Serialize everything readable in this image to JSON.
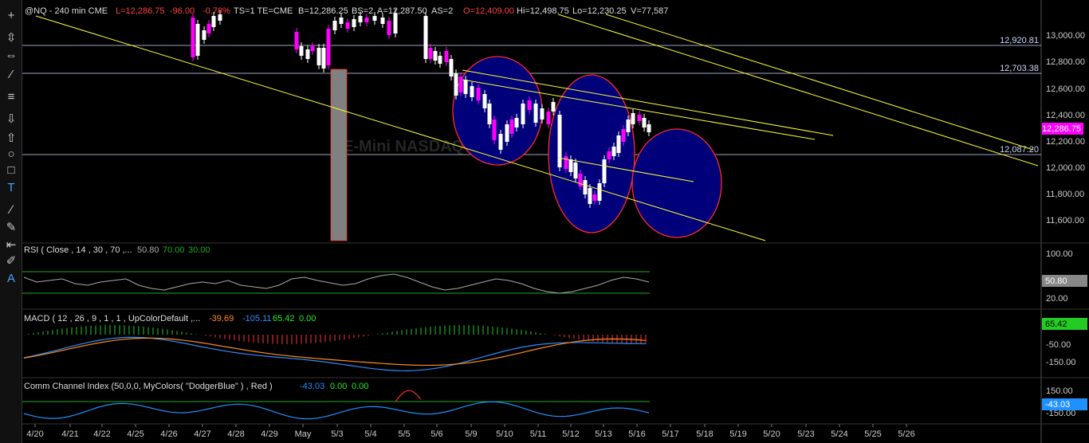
{
  "toolbar": {
    "tools": [
      {
        "icon": "crosshair-icon",
        "glyph": "+"
      },
      {
        "icon": "vertical-resize-icon",
        "glyph": "⇳"
      },
      {
        "icon": "horizontal-resize-icon",
        "glyph": "⇔"
      },
      {
        "icon": "trendline-icon",
        "glyph": "⁄"
      },
      {
        "icon": "horizontal-lines-icon",
        "glyph": "≡"
      },
      {
        "icon": "arrow-down-icon",
        "glyph": "⇩"
      },
      {
        "icon": "arrow-up-icon",
        "glyph": "⇧"
      },
      {
        "icon": "ellipse-icon",
        "glyph": "○"
      },
      {
        "icon": "rectangle-icon",
        "glyph": "□"
      },
      {
        "icon": "text-tool-icon",
        "glyph": "T"
      },
      {
        "icon": "pencil-icon",
        "glyph": "∕"
      },
      {
        "icon": "eraser-icon",
        "glyph": "✎"
      },
      {
        "icon": "fibonacci-icon",
        "glyph": "⇤"
      },
      {
        "icon": "pen-icon",
        "glyph": "✐"
      },
      {
        "icon": "text-label-icon",
        "glyph": "A"
      }
    ]
  },
  "header": {
    "symbol": "@NQ - 240 min  CME",
    "last": "L=12,286.75",
    "change": "-96.00",
    "change_pct": "-0.78%",
    "ts": "TS=1  TE=CME",
    "bid": "B=12,286.25",
    "bid_size": "BS=2",
    "ask": "A=12,287.50",
    "ask_size": "AS=2",
    "open": "O=12,409.00",
    "high": "Hi=12,498.75",
    "low": "Lo=12,230.25",
    "volume": "V=77,587"
  },
  "watermark": "E-Mini NASDAQ 100",
  "price_axis": {
    "ticks": [
      "13,000.00",
      "12,800.00",
      "12,600.00",
      "12,400.00",
      "12,200.00",
      "12,000.00",
      "11,800.00",
      "11,600.00"
    ],
    "current_label": "12,286.75",
    "levels": [
      "12,920.81",
      "12,703.38",
      "12,087.20"
    ]
  },
  "rsi": {
    "title": "RSI ( Close , 14 , 30 , 70 ,...",
    "v1": "50.80",
    "v2": "70.00",
    "v3": "30.00",
    "axis": [
      "100.00",
      "20.00"
    ],
    "current": "50.80"
  },
  "macd": {
    "title": "MACD ( 12 , 26 , 9 , 1 , 1 , UpColorDefault ,...",
    "v1": "-39.69",
    "v2": "-105.11",
    "v3": "65.42",
    "v4": "0.00",
    "axis": [
      "-50.00",
      "-150.00"
    ],
    "current": "65.42"
  },
  "cci": {
    "title": "Comm Channel Index (50,0,0, MyColors( \"DodgerBlue\" ) , Red )",
    "v1": "-43.03",
    "v2": "0.00",
    "v3": "0.00",
    "axis": [
      "150.00",
      "-150.00"
    ],
    "current": "-43.03"
  },
  "date_axis": [
    "4/20",
    "4/21",
    "4/22",
    "4/25",
    "4/26",
    "4/27",
    "4/28",
    "4/29",
    "May",
    "5/3",
    "5/4",
    "5/5",
    "5/6",
    "5/9",
    "5/10",
    "5/11",
    "5/12",
    "5/13",
    "5/16",
    "5/17",
    "5/18",
    "5/19",
    "5/20",
    "5/23",
    "5/24",
    "5/25",
    "5/26"
  ],
  "colors": {
    "up": "#ffffff",
    "down": "#ff00ff",
    "trend": "#ffff33",
    "ellipse_fill": "#00007a",
    "ellipse_stroke": "#ff2a2a",
    "rsi": "#aaaaaa",
    "macd_line": "#2e8bff",
    "signal": "#ff8c1a",
    "cci": "#1e90ff",
    "ref_green": "#22aa22",
    "hist_up": "#22cc22",
    "hist_down": "#ff3333"
  }
}
